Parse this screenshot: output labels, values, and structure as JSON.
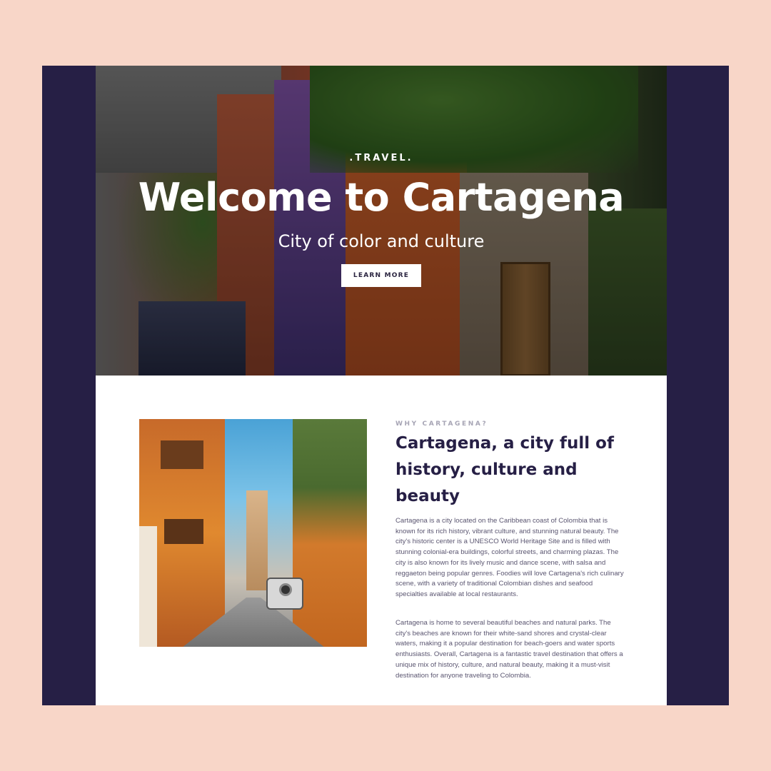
{
  "hero": {
    "kicker": ".TRAVEL.",
    "title": "Welcome to Cartagena",
    "subtitle": "City of color and culture",
    "button_label": "LEARN MORE"
  },
  "about": {
    "label": "WHY CARTAGENA?",
    "heading": "Cartagena, a city full of history, culture and beauty",
    "paragraphs": [
      "Cartagena is a city located on the Caribbean coast of Colombia that is known for its rich history, vibrant culture, and stunning natural beauty. The city's historic center is a UNESCO World Heritage Site and is filled with stunning colonial-era buildings, colorful streets, and charming plazas. The city is also known for its lively music and dance scene, with salsa and reggaeton being popular genres. Foodies will love Cartagena's rich culinary scene, with a variety of traditional Colombian dishes and seafood specialties available at local restaurants.",
      "Cartagena is home to several beautiful beaches and natural parks. The city's beaches are known for their white-sand shores and crystal-clear waters, making it a popular destination for beach-goers and water sports enthusiasts. Overall, Cartagena is a fantastic travel destination that offers a unique mix of history, culture, and natural beauty, making it a must-visit destination for anyone traveling to Colombia."
    ]
  },
  "colors": {
    "background": "#f8d6c8",
    "frame": "#261f45",
    "heading": "#261f45",
    "label": "#a7a5b5",
    "body_text": "#5a5570"
  }
}
